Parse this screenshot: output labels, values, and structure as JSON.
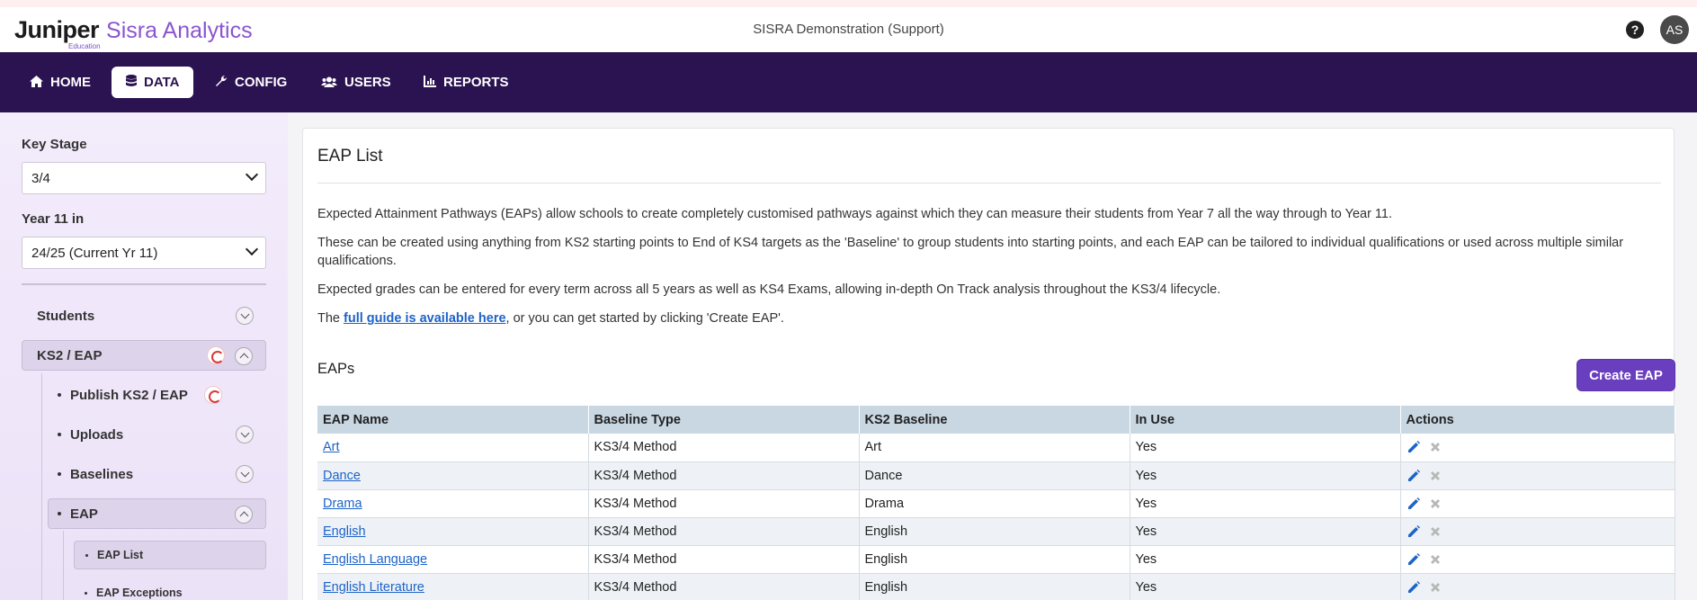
{
  "header": {
    "logo_main": "Juniper",
    "logo_sub": "Education",
    "logo_product": "Sisra Analytics",
    "org_name": "SISRA Demonstration (Support)",
    "help_glyph": "?",
    "avatar_initials": "AS"
  },
  "nav": {
    "items": [
      {
        "label": "HOME",
        "icon": "home-icon",
        "active": false
      },
      {
        "label": "DATA",
        "icon": "database-icon",
        "active": true
      },
      {
        "label": "CONFIG",
        "icon": "wrench-icon",
        "active": false
      },
      {
        "label": "USERS",
        "icon": "users-icon",
        "active": false
      },
      {
        "label": "REPORTS",
        "icon": "chart-icon",
        "active": false
      }
    ]
  },
  "sidebar": {
    "key_stage_label": "Key Stage",
    "key_stage_value": "3/4",
    "year_label": "Year 11 in",
    "year_value": "24/25 (Current Yr 11)",
    "items": [
      {
        "label": "Students"
      },
      {
        "label": "KS2 / EAP"
      },
      {
        "label": "Publish KS2 / EAP"
      },
      {
        "label": "Uploads"
      },
      {
        "label": "Baselines"
      },
      {
        "label": "EAP"
      },
      {
        "label": "EAP List"
      },
      {
        "label": "EAP Exceptions"
      }
    ]
  },
  "main": {
    "title": "EAP List",
    "para1": "Expected Attainment Pathways (EAPs) allow schools to create completely customised pathways against which they can measure their students from Year 7 all the way through to Year 11.",
    "para2": "These can be created using anything from KS2 starting points to End of KS4 targets as the 'Baseline' to group students into starting points, and each EAP can be tailored to individual qualifications or used across multiple similar qualifications.",
    "para3": "Expected grades can be entered for every term across all 5 years as well as KS4 Exams, allowing in-depth On Track analysis throughout the KS3/4 lifecycle.",
    "para4_prefix": "The ",
    "para4_link": "full guide is available here",
    "para4_suffix": ", or you can get started by clicking 'Create EAP'.",
    "eaps_title": "EAPs",
    "create_button": "Create EAP",
    "table": {
      "headers": [
        "EAP Name",
        "Baseline Type",
        "KS2 Baseline",
        "In Use",
        "Actions"
      ],
      "rows": [
        {
          "name": "Art",
          "baseline_type": "KS3/4 Method",
          "ks2_baseline": "Art",
          "in_use": "Yes"
        },
        {
          "name": "Dance",
          "baseline_type": "KS3/4 Method",
          "ks2_baseline": "Dance",
          "in_use": "Yes"
        },
        {
          "name": "Drama",
          "baseline_type": "KS3/4 Method",
          "ks2_baseline": "Drama",
          "in_use": "Yes"
        },
        {
          "name": "English",
          "baseline_type": "KS3/4 Method",
          "ks2_baseline": "English",
          "in_use": "Yes"
        },
        {
          "name": "English Language",
          "baseline_type": "KS3/4 Method",
          "ks2_baseline": "English",
          "in_use": "Yes"
        },
        {
          "name": "English Literature",
          "baseline_type": "KS3/4 Method",
          "ks2_baseline": "English",
          "in_use": "Yes"
        }
      ]
    }
  },
  "colors": {
    "nav_bg": "#2b1250",
    "accent": "#6a3fbf",
    "link": "#1d63c8",
    "table_header": "#c9d7e3"
  }
}
